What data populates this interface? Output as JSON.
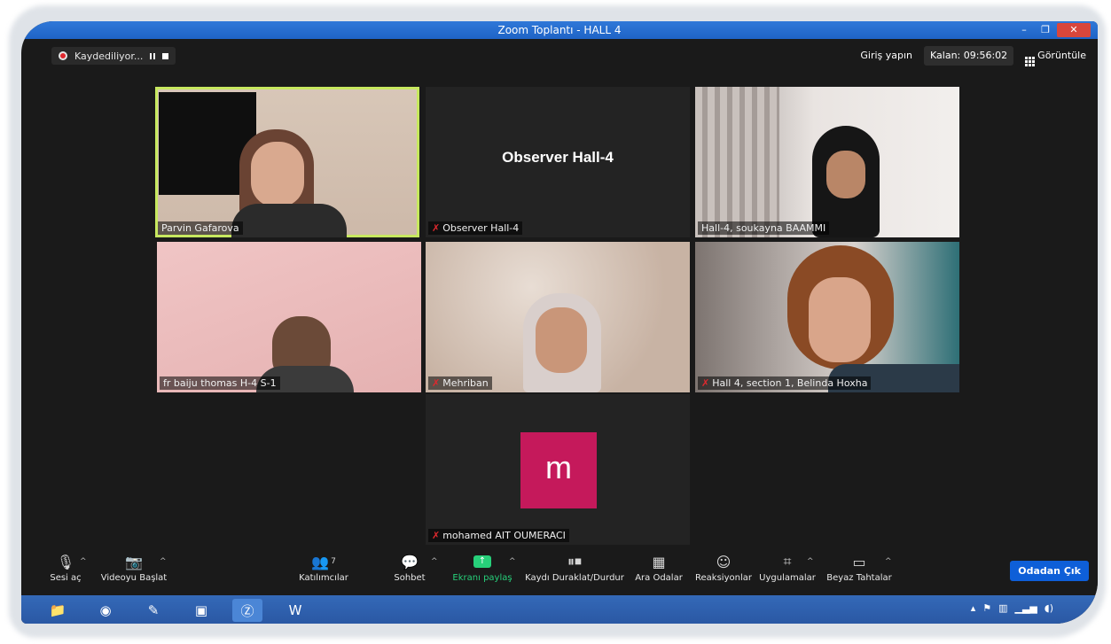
{
  "window": {
    "title": "Zoom Toplantı - HALL 4",
    "controls": [
      "–",
      "❐",
      "✕"
    ]
  },
  "topbar": {
    "recording_label": "Kaydediliyor...",
    "sign_in": "Giriş yapın",
    "remaining": "Kalan: 09:56:02",
    "view": "Görüntüle"
  },
  "participants": [
    {
      "name": "Parvin Gafarova",
      "muted": false,
      "active": true
    },
    {
      "name": "Observer Hall-4",
      "muted": true,
      "video_off": true,
      "display": "Observer Hall-4"
    },
    {
      "name": "Hall-4, soukayna BAAMMI",
      "muted": false
    },
    {
      "name": "fr  baiju thomas H-4 S-1",
      "muted": false
    },
    {
      "name": "Mehriban",
      "muted": true
    },
    {
      "name": "Hall 4, section 1, Belinda Hoxha",
      "muted": true
    },
    {
      "name": "mohamed AIT OUMERACI",
      "muted": true,
      "video_off": true,
      "avatar_letter": "m",
      "avatar_color": "#c5195b"
    }
  ],
  "toolbar": {
    "audio": "Sesi aç",
    "video": "Videoyu Başlat",
    "participants": "Katılımcılar",
    "participants_count": "7",
    "chat": "Sohbet",
    "share": "Ekranı paylaş",
    "record": "Kaydı Duraklat/Durdur",
    "breakout": "Ara Odalar",
    "reactions": "Reaksiyonlar",
    "apps": "Uygulamalar",
    "whiteboard": "Beyaz Tahtalar",
    "leave": "Odadan Çık"
  },
  "colors": {
    "active_speaker": "#c7e85f",
    "share_green": "#27d07a",
    "leave_blue": "#0e5fd8",
    "mute_red": "#e0282e"
  }
}
